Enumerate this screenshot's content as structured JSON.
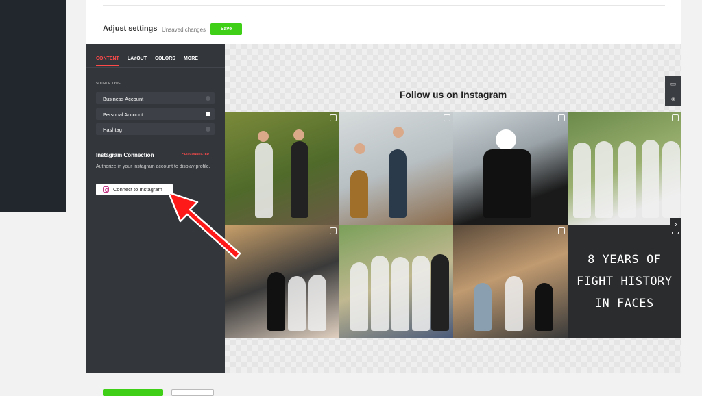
{
  "header": {
    "title": "Adjust settings",
    "status": "Unsaved changes",
    "save_label": "Save"
  },
  "panel": {
    "tabs": [
      {
        "label": "CONTENT",
        "active": true
      },
      {
        "label": "LAYOUT",
        "active": false
      },
      {
        "label": "COLORS",
        "active": false
      },
      {
        "label": "MORE",
        "active": false
      }
    ],
    "source_type_label": "SOURCE TYPE",
    "source_options": [
      {
        "label": "Business Account",
        "selected": false
      },
      {
        "label": "Personal Account",
        "selected": true
      },
      {
        "label": "Hashtag",
        "selected": false
      }
    ],
    "connection_title": "Instagram Connection",
    "connection_status": "• DISCONNECTED",
    "connection_description": "Authorize in your Instagram account to display profile.",
    "connect_button_label": "Connect to Instagram"
  },
  "preview": {
    "feed_title": "Follow us on Instagram",
    "poster_text_line1": "8 YEARS OF",
    "poster_text_line2": "FIGHT HISTORY IN FACES",
    "side_controls": [
      "desktop-icon",
      "paint-bucket-icon"
    ],
    "next_icon": "chevron-right-icon"
  },
  "colors": {
    "accent_green": "#3ecf16",
    "accent_red": "#ff4a4a",
    "panel_bg": "#33373c",
    "annotation_arrow": "#ff1a1a"
  }
}
